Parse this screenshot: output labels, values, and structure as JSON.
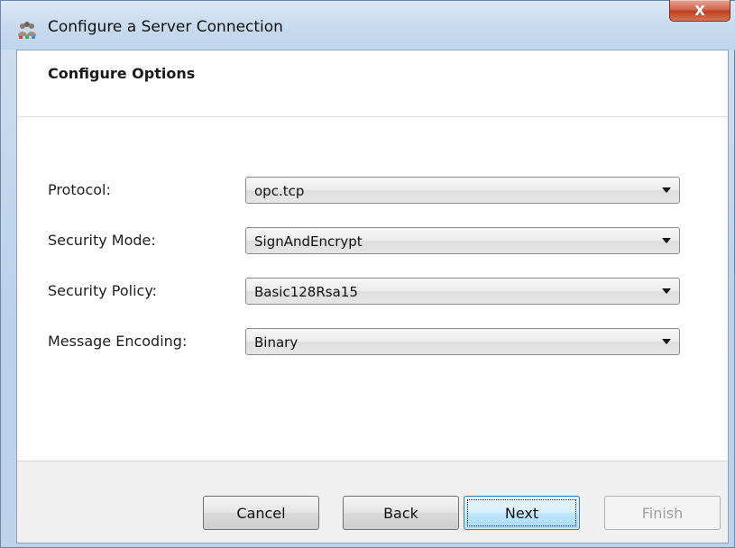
{
  "window": {
    "title": "Configure a Server Connection",
    "app_icon": "users-network-icon",
    "close_label": "X"
  },
  "page": {
    "section_title": "Configure Options"
  },
  "form": {
    "fields": [
      {
        "label": "Protocol:",
        "value": "opc.tcp"
      },
      {
        "label": "Security Mode:",
        "value": "SignAndEncrypt"
      },
      {
        "label": "Security Policy:",
        "value": "Basic128Rsa15"
      },
      {
        "label": "Message Encoding:",
        "value": "Binary"
      }
    ]
  },
  "buttons": {
    "cancel": "Cancel",
    "back": "Back",
    "next": "Next",
    "finish": "Finish"
  },
  "colors": {
    "title_bar": "#c8dbef",
    "close_button": "#c0401f",
    "default_button": "#bee6fd",
    "disabled_text": "#a0a0a0"
  }
}
